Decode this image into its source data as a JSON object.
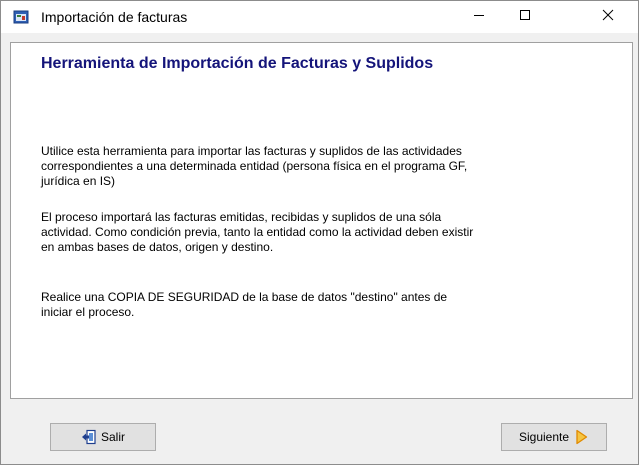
{
  "window": {
    "title": "Importación de facturas"
  },
  "content": {
    "heading": "Herramienta de Importación de Facturas y Suplidos",
    "paragraphs": [
      "Utilice esta herramienta para importar las facturas y suplidos de las actividades\ncorrespondientes a una determinada entidad (persona física en el programa GF,\njurídica en IS)",
      "El proceso importará las facturas emitidas, recibidas y suplidos de una sóla\nactividad. Como condición previa, tanto la entidad como la actividad deben existir\nen ambas bases de datos, origen y destino.",
      "Realice una COPIA DE SEGURIDAD de la base de datos \"destino\" antes de\niniciar el proceso."
    ]
  },
  "buttons": {
    "exit_label": "Salir",
    "next_label": "Siguiente"
  },
  "icons": {
    "app": "app-window-icon",
    "minimize": "minimize-icon",
    "maximize": "maximize-icon",
    "close": "close-icon",
    "exit": "exit-door-icon",
    "next": "arrow-right-icon"
  },
  "colors": {
    "heading": "#14147a",
    "next_arrow": "#f0a000"
  }
}
